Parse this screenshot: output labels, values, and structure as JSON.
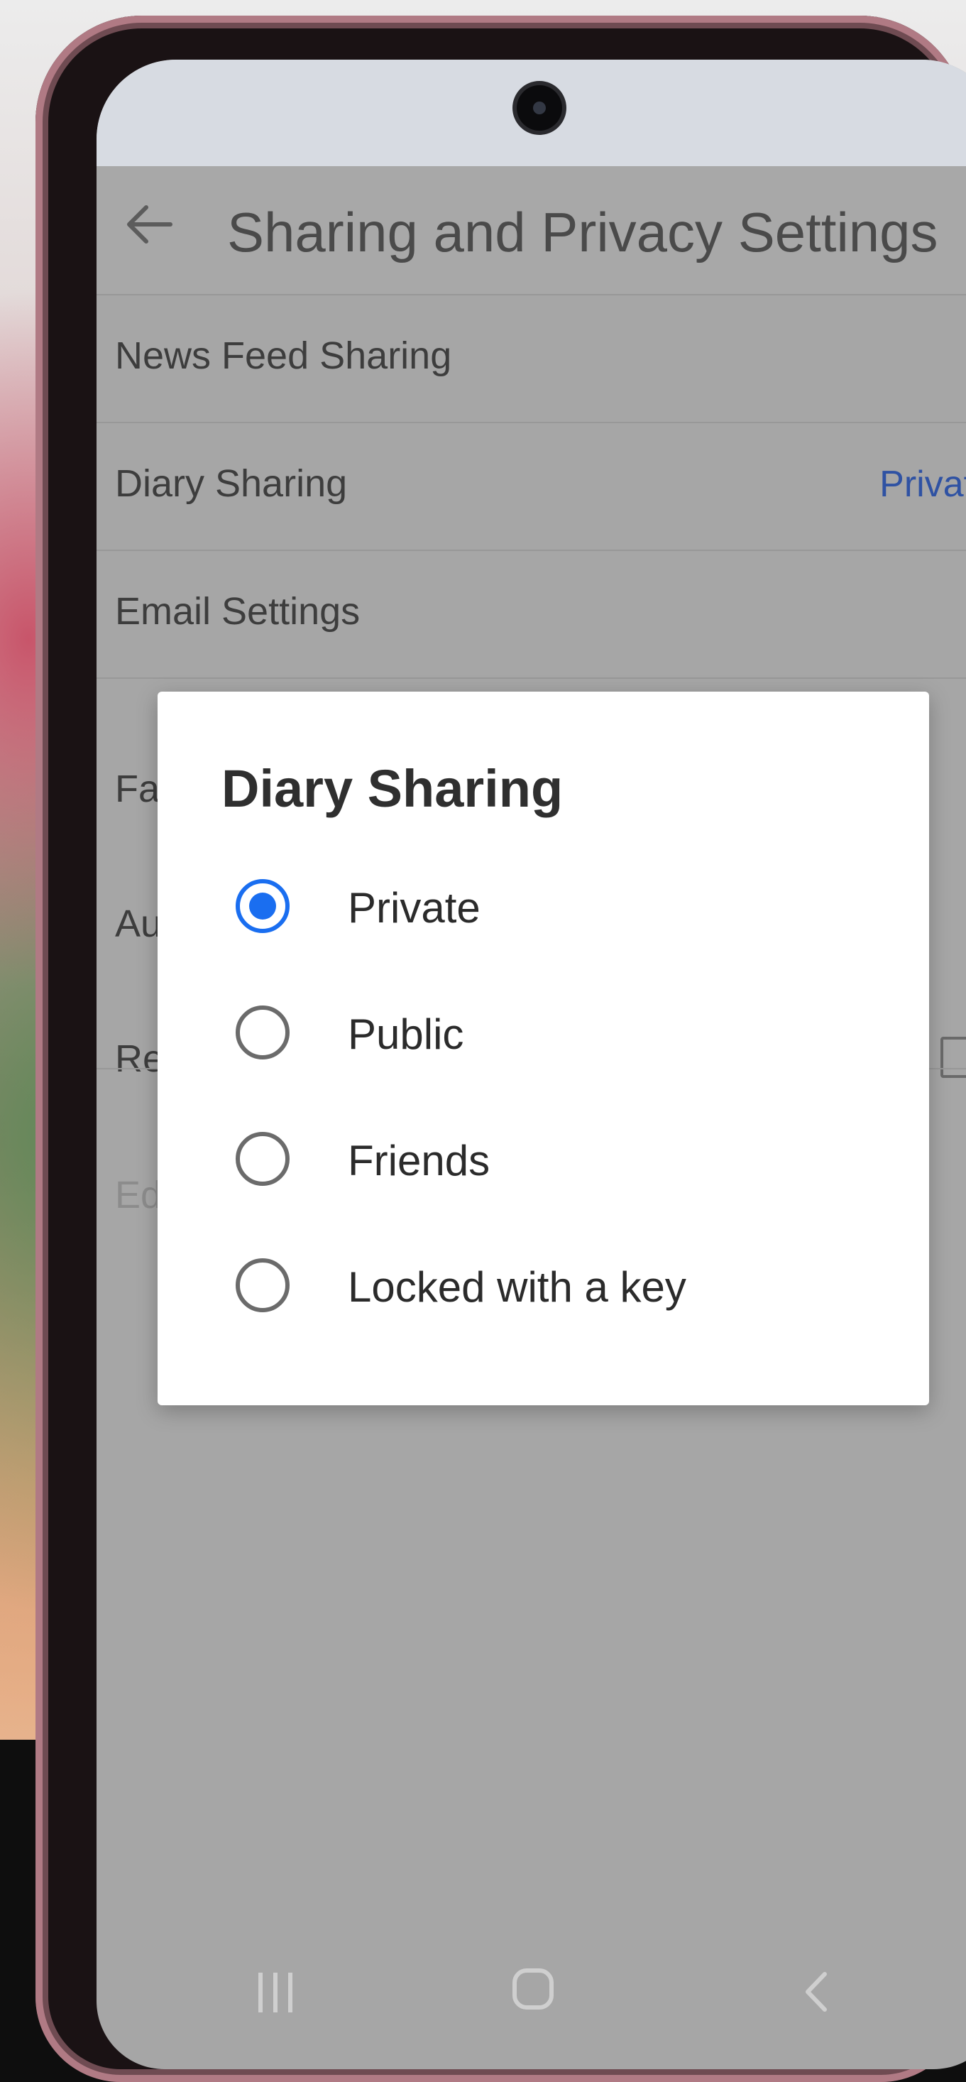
{
  "header": {
    "title": "Sharing and Privacy Settings"
  },
  "settings": {
    "rows": [
      {
        "label": "News Feed Sharing",
        "value": ""
      },
      {
        "label": "Diary Sharing",
        "value": "Private"
      },
      {
        "label": "Email Settings",
        "value": ""
      },
      {
        "label": "Fa",
        "value": ""
      },
      {
        "label": "Au",
        "value": ""
      },
      {
        "label": "Re",
        "value": ""
      },
      {
        "label": "Ed",
        "value": ""
      }
    ]
  },
  "dialog": {
    "title": "Diary Sharing",
    "options": [
      {
        "label": "Private",
        "selected": true
      },
      {
        "label": "Public",
        "selected": false
      },
      {
        "label": "Friends",
        "selected": false
      },
      {
        "label": "Locked with a key",
        "selected": false
      }
    ]
  },
  "colors": {
    "accent": "#1a6ef0",
    "link": "#2f52a3"
  },
  "icons": {
    "back": "arrow-left-icon",
    "recents": "recents-icon",
    "home": "home-icon",
    "nav_back": "chevron-left-icon"
  }
}
